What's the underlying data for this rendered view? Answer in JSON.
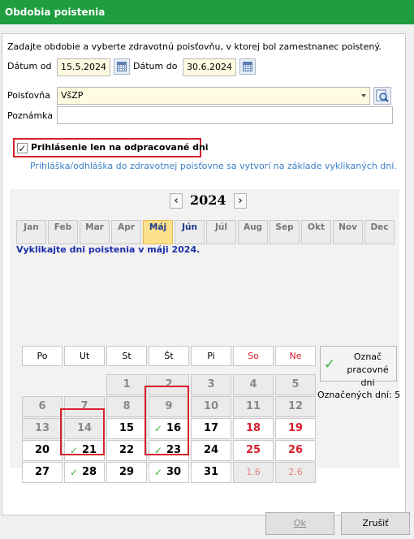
{
  "window": {
    "title": "Obdobia poistenia"
  },
  "intro": "Zadajte obdobie a vyberte zdravotnú poisťovňu, v ktorej bol zamestnanec poistený.",
  "date_from": {
    "label": "Dátum od",
    "value": "15.5.2024"
  },
  "date_to": {
    "label": "Dátum do",
    "value": "30.6.2024"
  },
  "insurer": {
    "label": "Poisťovňa",
    "value": "VšZP"
  },
  "note": {
    "label": "Poznámka",
    "value": ""
  },
  "worked_only": {
    "label": "Prihlásenie len na odpracované dni",
    "checked": true
  },
  "worked_only_hint": "Prihláška/odhláška do zdravotnej poisťovne sa vytvorí na základe vyklikaných dní.",
  "calendar": {
    "year": "2024",
    "prev": "‹",
    "next": "›",
    "months": [
      "Jan",
      "Feb",
      "Mar",
      "Apr",
      "Máj",
      "Jún",
      "Júl",
      "Aug",
      "Sep",
      "Okt",
      "Nov",
      "Dec"
    ],
    "active_month_index": 4,
    "instruction": "Vyklikajte dni poistenia v máji 2024.",
    "weekdays": [
      "Po",
      "Ut",
      "St",
      "Št",
      "Pi",
      "So",
      "Ne"
    ],
    "weeks": [
      [
        {
          "d": ""
        },
        {
          "d": ""
        },
        {
          "d": "1",
          "t": "grey"
        },
        {
          "d": "2",
          "t": "grey"
        },
        {
          "d": "3",
          "t": "grey"
        },
        {
          "d": "4",
          "t": "grey"
        },
        {
          "d": "5",
          "t": "grey"
        }
      ],
      [
        {
          "d": "6",
          "t": "grey"
        },
        {
          "d": "7",
          "t": "grey"
        },
        {
          "d": "8",
          "t": "grey"
        },
        {
          "d": "9",
          "t": "grey"
        },
        {
          "d": "10",
          "t": "grey"
        },
        {
          "d": "11",
          "t": "grey"
        },
        {
          "d": "12",
          "t": "grey"
        }
      ],
      [
        {
          "d": "13",
          "t": "grey"
        },
        {
          "d": "14",
          "t": "grey"
        },
        {
          "d": "15",
          "t": "cur"
        },
        {
          "d": "16",
          "t": "cur",
          "sel": true
        },
        {
          "d": "17",
          "t": "cur"
        },
        {
          "d": "18",
          "t": "red"
        },
        {
          "d": "19",
          "t": "red"
        }
      ],
      [
        {
          "d": "20",
          "t": "cur"
        },
        {
          "d": "21",
          "t": "cur",
          "sel": true
        },
        {
          "d": "22",
          "t": "cur"
        },
        {
          "d": "23",
          "t": "cur",
          "sel": true
        },
        {
          "d": "24",
          "t": "cur"
        },
        {
          "d": "25",
          "t": "red"
        },
        {
          "d": "26",
          "t": "red"
        }
      ],
      [
        {
          "d": "27",
          "t": "cur"
        },
        {
          "d": "28",
          "t": "cur",
          "sel": true
        },
        {
          "d": "29",
          "t": "cur"
        },
        {
          "d": "30",
          "t": "cur",
          "sel": true
        },
        {
          "d": "31",
          "t": "cur"
        },
        {
          "d": "1.6",
          "t": "dim"
        },
        {
          "d": "2.6",
          "t": "dim"
        }
      ]
    ],
    "mark_button": "Označ pracovné dni",
    "marked_count": "Označených dní: 5"
  },
  "buttons": {
    "ok": "Ok",
    "cancel": "Zrušiť"
  },
  "colors": {
    "titlebar": "#1e9e3e",
    "highlight_box": "#d8202c",
    "check": "#3cb43c",
    "weekend": "#d8202c"
  }
}
